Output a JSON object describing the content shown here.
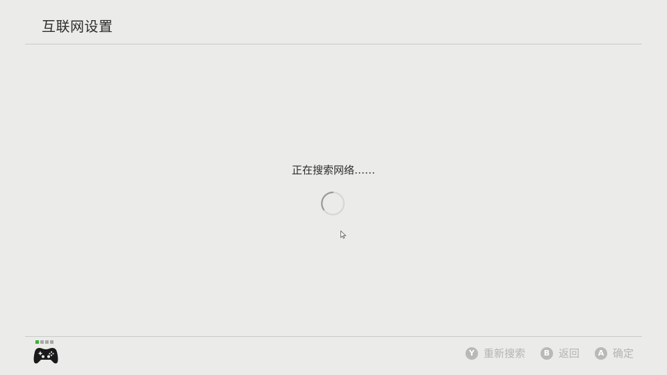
{
  "header": {
    "title": "互联网设置"
  },
  "main": {
    "status_text": "正在搜索网络……"
  },
  "footer": {
    "player_indicator": {
      "active_slot": 1,
      "slots": 4
    },
    "actions": [
      {
        "button": "Y",
        "label": "重新搜索"
      },
      {
        "button": "B",
        "label": "返回"
      },
      {
        "button": "A",
        "label": "确定"
      }
    ]
  },
  "colors": {
    "background": "#ebebe9",
    "text": "#2d2d2d",
    "muted": "#b4b4b2",
    "player_active": "#3ab03a"
  },
  "icons": {
    "spinner": "loading-spinner-icon",
    "controller": "gamepad-icon",
    "cursor": "mouse-pointer-icon"
  }
}
